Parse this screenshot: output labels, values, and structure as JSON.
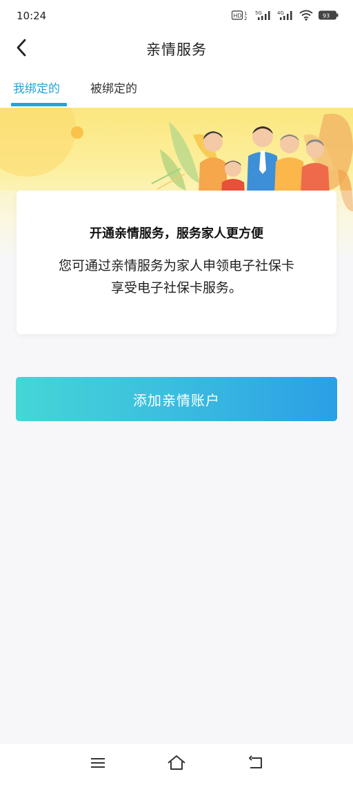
{
  "status_bar": {
    "time": "10:24",
    "battery": "93",
    "network_1": "5G",
    "network_2": "4G"
  },
  "header": {
    "title": "亲情服务"
  },
  "tabs": [
    {
      "label": "我绑定的",
      "active": true
    },
    {
      "label": "被绑定的",
      "active": false
    }
  ],
  "card": {
    "heading": "开通亲情服务，服务家人更方便",
    "line1": "您可通过亲情服务为家人申领电子社保卡",
    "line2": "享受电子社保卡服务。"
  },
  "add_button": {
    "label": "添加亲情账户"
  },
  "nav": {
    "icons": [
      "menu-icon",
      "home-icon",
      "back-return-icon"
    ]
  },
  "colors": {
    "accent": "#22a4d8",
    "button_start": "#45d6d6",
    "button_end": "#2b9fe6",
    "banner_yellow": "#fbe77f"
  }
}
